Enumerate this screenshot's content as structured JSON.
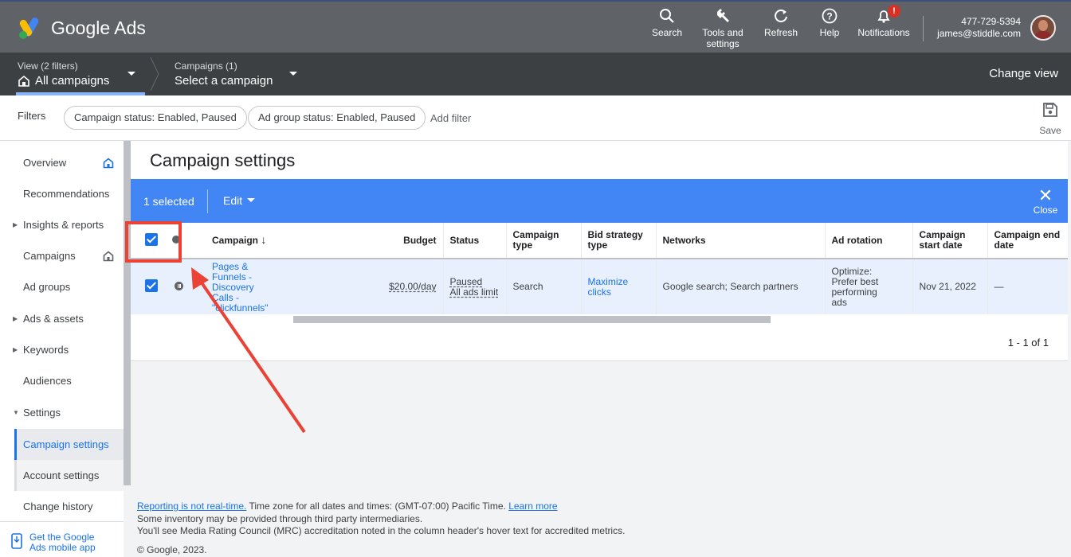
{
  "header": {
    "brand": "Google Ads",
    "tools": {
      "search": "Search",
      "tools_line1": "Tools and",
      "tools_line2": "settings",
      "refresh": "Refresh",
      "help": "Help",
      "notifications": "Notifications",
      "notif_badge": "!"
    },
    "account": {
      "id": "477-729-5394",
      "email": "james@stiddle.com"
    }
  },
  "navbar": {
    "view_small": "View (2 filters)",
    "view_big": "All campaigns",
    "campaigns_small": "Campaigns (1)",
    "campaigns_big": "Select a campaign",
    "change_view": "Change view"
  },
  "filters": {
    "label": "Filters",
    "chips": [
      "Campaign status: Enabled, Paused",
      "Ad group status: Enabled, Paused"
    ],
    "add_filter": "Add filter",
    "save": "Save"
  },
  "sidebar": {
    "items": [
      {
        "label": "Overview"
      },
      {
        "label": "Recommendations"
      },
      {
        "label": "Insights & reports"
      },
      {
        "label": "Campaigns"
      },
      {
        "label": "Ad groups"
      },
      {
        "label": "Ads & assets"
      },
      {
        "label": "Keywords"
      },
      {
        "label": "Audiences"
      },
      {
        "label": "Settings"
      },
      {
        "label": "Campaign settings"
      },
      {
        "label": "Account settings"
      },
      {
        "label": "Change history"
      }
    ],
    "mobile_line1": "Get the Google",
    "mobile_line2": "Ads mobile app"
  },
  "main": {
    "title": "Campaign settings",
    "selection": {
      "count": "1 selected",
      "edit": "Edit",
      "close": "Close"
    },
    "columns": {
      "campaign": "Campaign",
      "budget": "Budget",
      "status": "Status",
      "type_1": "Campaign",
      "type_2": "type",
      "bid_1": "Bid strategy",
      "bid_2": "type",
      "networks": "Networks",
      "rotation": "Ad rotation",
      "start_1": "Campaign",
      "start_2": "start date",
      "end_1": "Campaign end",
      "end_2": "date"
    },
    "row": {
      "campaign_1": "Pages &",
      "campaign_2": "Funnels -",
      "campaign_3": "Discovery",
      "campaign_4": "Calls -",
      "campaign_5": "\"clickfunnels\"",
      "budget": "$20.00/day",
      "status_1": "Paused",
      "status_2": "All ads limit",
      "type": "Search",
      "bid_1": "Maximize",
      "bid_2": "clicks",
      "networks": "Google search; Search partners",
      "rotation_1": "Optimize:",
      "rotation_2": "Prefer best",
      "rotation_3": "performing",
      "rotation_4": "ads",
      "start": "Nov 21, 2022",
      "end": "—"
    },
    "pagination": "1 - 1 of 1"
  },
  "footer": {
    "realtime_link": "Reporting is not real-time.",
    "timezone": " Time zone for all dates and times: (GMT-07:00) Pacific Time. ",
    "learn_more": "Learn more",
    "line2": "Some inventory may be provided through third party intermediaries.",
    "line3": "You'll see Media Rating Council (MRC) accreditation noted in the column header's hover text for accredited metrics.",
    "copyright": "© Google, 2023."
  },
  "colors": {
    "accent": "#1a73e8",
    "selection_bar": "#4285f4",
    "highlight": "#ea4335"
  }
}
